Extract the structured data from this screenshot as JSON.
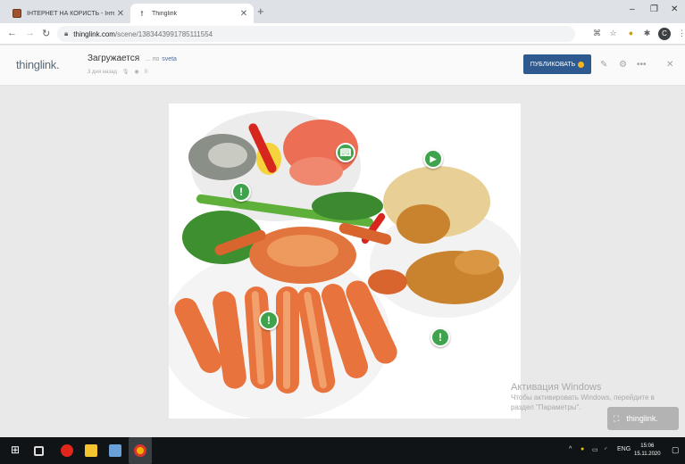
{
  "browser": {
    "tabs": [
      {
        "title": "ІНТЕРНЕТ НА КОРИСТЬ - Інтер",
        "active": false
      },
      {
        "title": "Thinglink",
        "active": true
      }
    ],
    "new_tab_icon": "plus-icon",
    "url_host": "thinglink.com",
    "url_path": "/scene/1383443991785111554",
    "profile_initial": "C"
  },
  "header": {
    "logo": "thinglink.",
    "scene_title": "Загружается",
    "by_text": "... по",
    "author": "sveta",
    "time_ago": "3 дня назад",
    "view_count": "0",
    "publish_label": "ПУБЛИКОВАТЬ",
    "colors": {
      "publish": "#2f5a8f",
      "tag": "#3fa34d"
    }
  },
  "scene": {
    "tags": [
      {
        "icon": "book-icon"
      },
      {
        "icon": "play-icon"
      },
      {
        "icon": "exclamation-icon"
      },
      {
        "icon": "exclamation-icon"
      },
      {
        "icon": "exclamation-icon"
      }
    ],
    "badge_label": "thinglink."
  },
  "watermark": {
    "line1": "Активация Windows",
    "line2": "Чтобы активировать Windows, перейдите в",
    "line3": "раздел \"Параметры\"."
  },
  "taskbar": {
    "lang": "ENG",
    "time": "15:06",
    "date": "15.11.2020"
  }
}
